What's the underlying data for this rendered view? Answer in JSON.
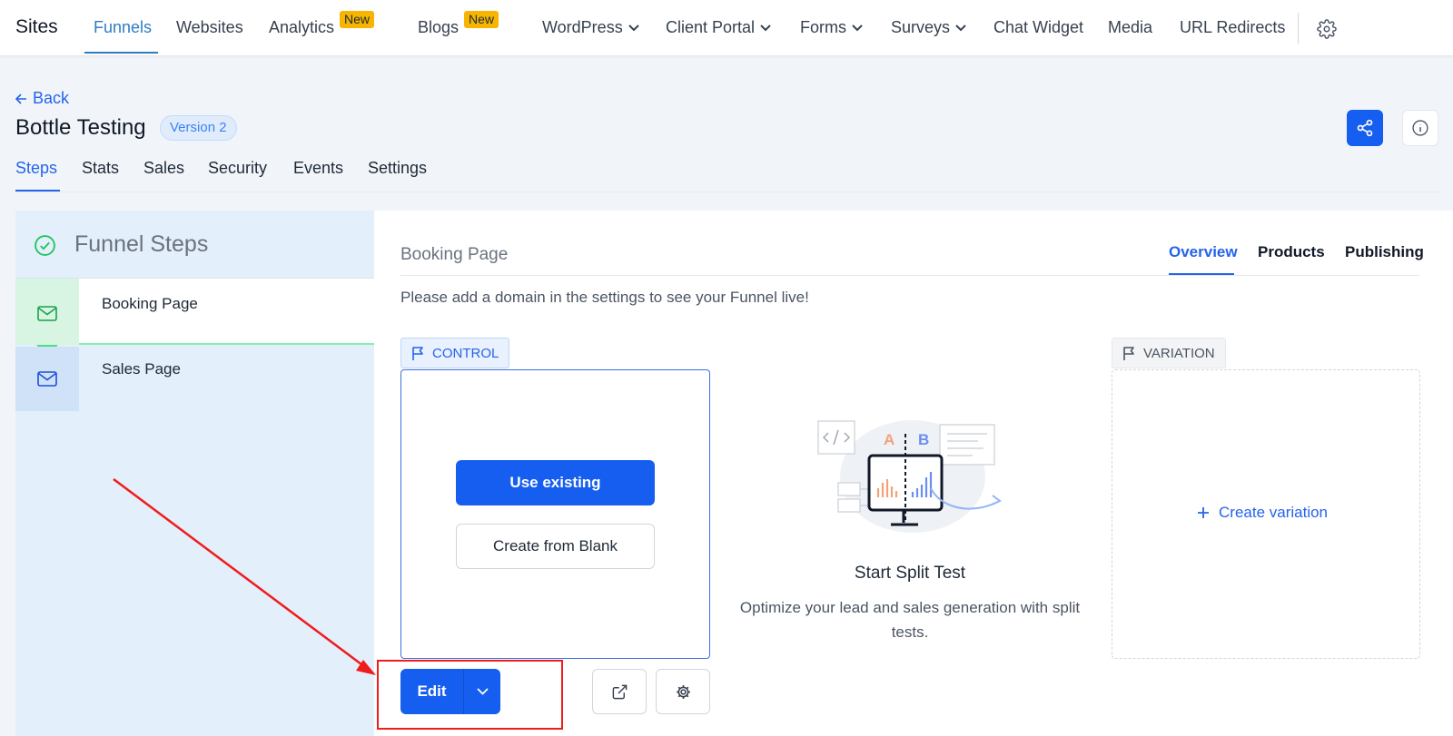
{
  "nav": {
    "brand": "Sites",
    "items": [
      {
        "label": "Funnels"
      },
      {
        "label": "Websites"
      },
      {
        "label": "Analytics",
        "badge": "New"
      },
      {
        "label": "Blogs",
        "badge": "New"
      },
      {
        "label": "WordPress"
      },
      {
        "label": "Client Portal"
      },
      {
        "label": "Forms"
      },
      {
        "label": "Surveys"
      },
      {
        "label": "Chat Widget"
      },
      {
        "label": "Media"
      },
      {
        "label": "URL Redirects"
      }
    ]
  },
  "header": {
    "back_label": "Back",
    "title": "Bottle Testing",
    "version": "Version 2"
  },
  "tabs": [
    "Steps",
    "Stats",
    "Sales",
    "Security",
    "Events",
    "Settings"
  ],
  "funnel_steps": {
    "title": "Funnel Steps",
    "steps": [
      {
        "label": "Booking Page"
      },
      {
        "label": "Sales Page"
      }
    ]
  },
  "main": {
    "page_title": "Booking Page",
    "tabs": [
      "Overview",
      "Products",
      "Publishing"
    ],
    "notice": "Please add a domain in the settings to see your Funnel live!",
    "control_label": "CONTROL",
    "variation_label": "VARIATION",
    "use_existing": "Use existing",
    "create_blank": "Create from Blank",
    "edit_label": "Edit",
    "split_title": "Start Split Test",
    "split_desc": "Optimize your lead and sales generation with split tests.",
    "create_variation": "Create variation",
    "illus_a": "A",
    "illus_b": "B"
  },
  "colors": {
    "primary": "#155eef",
    "accent_nav": "#2f7dc0",
    "badge": "#f7b500",
    "success": "#22c55e",
    "annotation": "#ef1c1c"
  }
}
